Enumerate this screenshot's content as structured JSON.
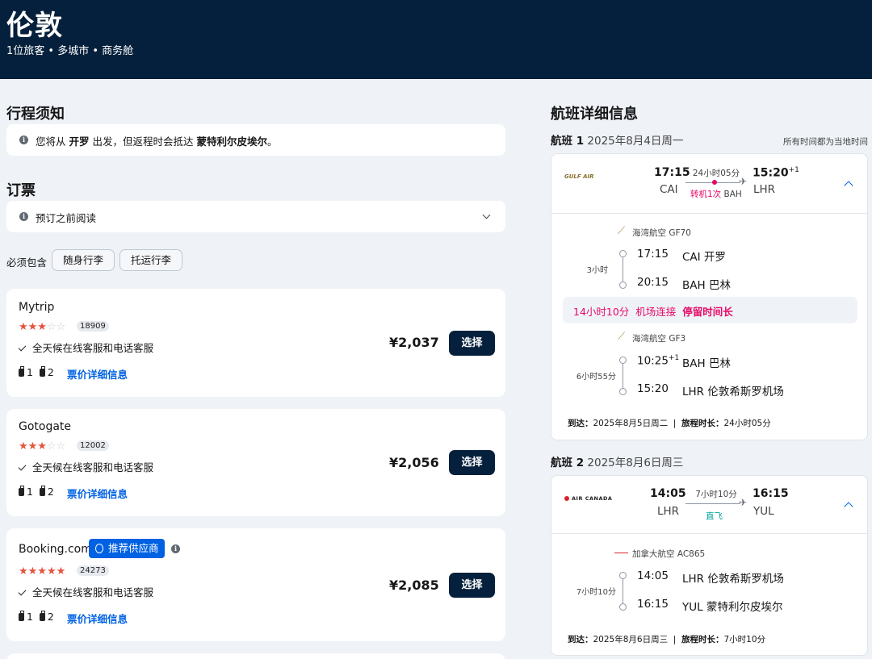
{
  "header": {
    "city": "伦敦",
    "subtitle": "1位旅客 • 多城市 • 商务舱"
  },
  "notice": {
    "title": "行程须知",
    "text_prefix": "您将从 ",
    "origin": "开罗",
    "text_mid": " 出发，但返程时会抵达 ",
    "destination": "蒙特利尔皮埃尔",
    "text_suffix": "。"
  },
  "booking": {
    "title": "订票",
    "read_before": "预订之前阅读",
    "must_include": "必须包含",
    "filters": [
      "随身行李",
      "托运行李"
    ]
  },
  "offers": [
    {
      "provider": "Mytrip",
      "stars": 3,
      "reviews": "18909",
      "service": "全天候在线客服和电话客服",
      "carry_on": "1",
      "checked": "2",
      "fare_link": "票价详细信息",
      "price": "¥2,037",
      "button": "选择"
    },
    {
      "provider": "Gotogate",
      "stars": 3,
      "reviews": "12002",
      "service": "全天候在线客服和电话客服",
      "carry_on": "1",
      "checked": "2",
      "fare_link": "票价详细信息",
      "price": "¥2,056",
      "button": "选择"
    },
    {
      "provider": "Booking.com",
      "badge": "推荐供应商",
      "stars": 5,
      "reviews": "24273",
      "service": "全天候在线客服和电话客服",
      "carry_on": "1",
      "checked": "2",
      "fare_link": "票价详细信息",
      "price": "¥2,085",
      "button": "选择"
    }
  ],
  "flight_details": {
    "title": "航班详细信息",
    "local_time_note": "所有时间都为当地时间",
    "flights": [
      {
        "label": "航班 1",
        "date": "2025年8月4日周一",
        "airline_logo": "GULF AIR",
        "depart_time": "17:15",
        "depart_code": "CAI",
        "arrive_time": "15:20",
        "arrive_plus": "+1",
        "arrive_code": "LHR",
        "duration": "24小时05分",
        "stops": "转机1次",
        "stop_code": "BAH",
        "segments": [
          {
            "airline": "海湾航空 GF70",
            "dep_time": "17:15",
            "dep_plus": "",
            "dep_place": "CAI 开罗",
            "arr_time": "20:15",
            "arr_place": "BAH 巴林",
            "duration": "3小时"
          },
          {
            "airline": "海湾航空 GF3",
            "dep_time": "10:25",
            "dep_plus": "+1",
            "dep_place": "BAH 巴林",
            "arr_time": "15:20",
            "arr_place": "LHR 伦敦希斯罗机场",
            "duration": "6小时55分"
          }
        ],
        "layover": {
          "duration": "14小时10分",
          "type": "机场连接",
          "warning": "停留时间长"
        },
        "arrive_label": "到达：",
        "arrive_date": "2025年8月5日周二",
        "trip_label": "旅程时长：",
        "trip_duration": "24小时05分"
      },
      {
        "label": "航班 2",
        "date": "2025年8月6日周三",
        "airline_logo": "AIR CANADA",
        "depart_time": "14:05",
        "depart_code": "LHR",
        "arrive_time": "16:15",
        "arrive_code": "YUL",
        "duration": "7小时10分",
        "stops": "直飞",
        "segments": [
          {
            "airline": "加拿大航空 AC865",
            "dep_time": "14:05",
            "dep_place": "LHR 伦敦希斯罗机场",
            "arr_time": "16:15",
            "arr_place": "YUL 蒙特利尔皮埃尔",
            "duration": "7小时10分"
          }
        ],
        "arrive_label": "到达：",
        "arrive_date": "2025年8月6日周三",
        "trip_label": "旅程时长：",
        "trip_duration": "7小时10分"
      }
    ]
  },
  "colors": {
    "header_bg": "#05203c",
    "accent": "#0062e3",
    "alert": "#e70866",
    "star": "#e5533d"
  }
}
